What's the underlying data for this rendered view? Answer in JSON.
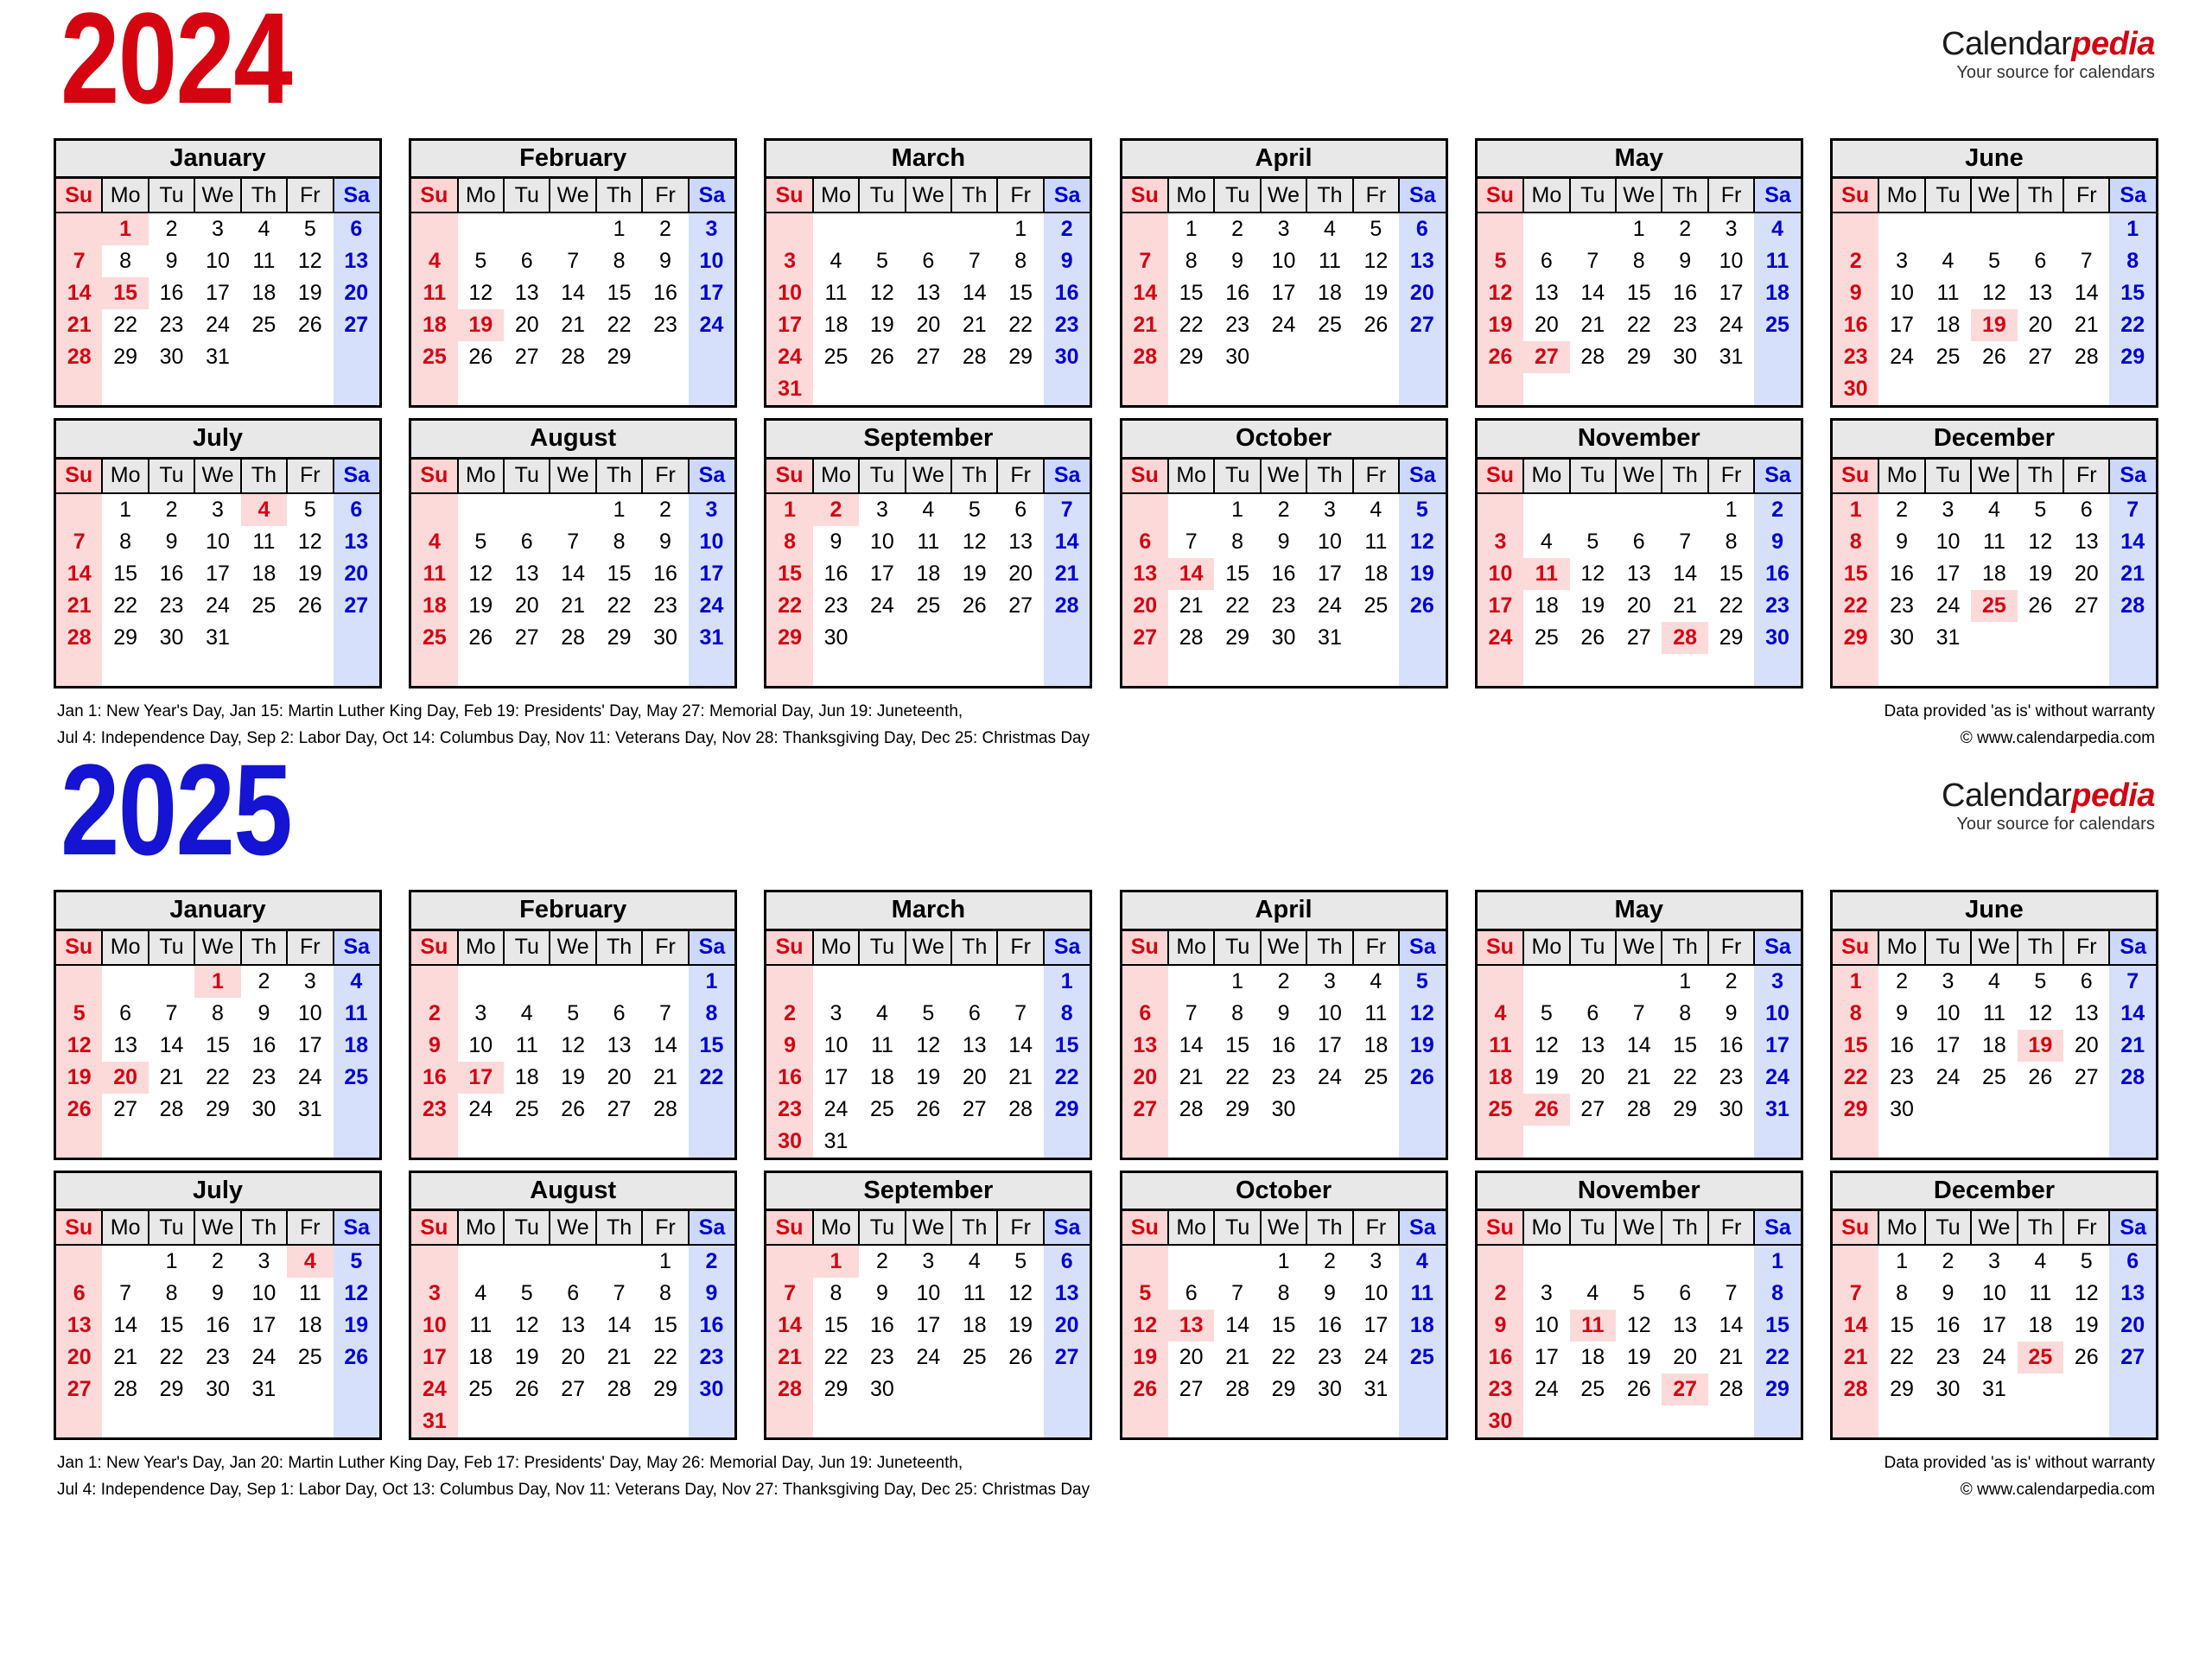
{
  "colors": {
    "year_2024": "#d40511",
    "year_2025": "#1414d2",
    "sunday_text": "#d40511",
    "saturday_text": "#0000d2",
    "sunday_bg": "#fcdada",
    "saturday_bg": "#d6e0fb",
    "holiday_bg": "#fcdada",
    "header_bg": "#e8e8e8"
  },
  "logo": {
    "main_black": "Calendar",
    "main_red": "pedia",
    "tagline": "Your source for calendars"
  },
  "weekdays": [
    "Su",
    "Mo",
    "Tu",
    "We",
    "Th",
    "Fr",
    "Sa"
  ],
  "years": [
    {
      "title": "2024",
      "accent": "#d40511",
      "holidays_line1": "Jan 1: New Year's Day, Jan 15: Martin Luther King Day, Feb 19: Presidents' Day, May 27: Memorial Day, Jun 19: Juneteenth,",
      "holidays_line2": "Jul 4: Independence Day, Sep 2: Labor Day, Oct 14: Columbus Day, Nov 11: Veterans Day, Nov 28: Thanksgiving Day, Dec 25: Christmas Day",
      "legal_line1": "Data provided 'as is' without warranty",
      "legal_line2": "© www.calendarpedia.com",
      "months": [
        {
          "name": "January",
          "start": 1,
          "days": 31,
          "holidays": [
            1,
            15
          ]
        },
        {
          "name": "February",
          "start": 4,
          "days": 29,
          "holidays": [
            19
          ]
        },
        {
          "name": "March",
          "start": 5,
          "days": 31,
          "holidays": []
        },
        {
          "name": "April",
          "start": 1,
          "days": 30,
          "holidays": []
        },
        {
          "name": "May",
          "start": 3,
          "days": 31,
          "holidays": [
            27
          ]
        },
        {
          "name": "June",
          "start": 6,
          "days": 30,
          "holidays": [
            19
          ]
        },
        {
          "name": "July",
          "start": 1,
          "days": 31,
          "holidays": [
            4
          ]
        },
        {
          "name": "August",
          "start": 4,
          "days": 31,
          "holidays": []
        },
        {
          "name": "September",
          "start": 0,
          "days": 30,
          "holidays": [
            2
          ]
        },
        {
          "name": "October",
          "start": 2,
          "days": 31,
          "holidays": [
            14
          ]
        },
        {
          "name": "November",
          "start": 5,
          "days": 30,
          "holidays": [
            11,
            28
          ]
        },
        {
          "name": "December",
          "start": 0,
          "days": 31,
          "holidays": [
            25
          ]
        }
      ]
    },
    {
      "title": "2025",
      "accent": "#1414d2",
      "holidays_line1": "Jan 1: New Year's Day, Jan 20: Martin Luther King Day, Feb 17: Presidents' Day, May 26: Memorial Day, Jun 19: Juneteenth,",
      "holidays_line2": "Jul 4: Independence Day, Sep 1: Labor Day, Oct 13: Columbus Day, Nov 11: Veterans Day, Nov 27: Thanksgiving Day, Dec 25: Christmas Day",
      "legal_line1": "Data provided 'as is' without warranty",
      "legal_line2": "© www.calendarpedia.com",
      "months": [
        {
          "name": "January",
          "start": 3,
          "days": 31,
          "holidays": [
            1,
            20
          ]
        },
        {
          "name": "February",
          "start": 6,
          "days": 28,
          "holidays": [
            17
          ]
        },
        {
          "name": "March",
          "start": 6,
          "days": 31,
          "holidays": []
        },
        {
          "name": "April",
          "start": 2,
          "days": 30,
          "holidays": []
        },
        {
          "name": "May",
          "start": 4,
          "days": 31,
          "holidays": [
            26
          ]
        },
        {
          "name": "June",
          "start": 0,
          "days": 30,
          "holidays": [
            19
          ]
        },
        {
          "name": "July",
          "start": 2,
          "days": 31,
          "holidays": [
            4
          ]
        },
        {
          "name": "August",
          "start": 5,
          "days": 31,
          "holidays": []
        },
        {
          "name": "September",
          "start": 1,
          "days": 30,
          "holidays": [
            1
          ]
        },
        {
          "name": "October",
          "start": 3,
          "days": 31,
          "holidays": [
            13
          ]
        },
        {
          "name": "November",
          "start": 6,
          "days": 30,
          "holidays": [
            11,
            27
          ]
        },
        {
          "name": "December",
          "start": 1,
          "days": 31,
          "holidays": [
            25
          ]
        }
      ]
    }
  ]
}
